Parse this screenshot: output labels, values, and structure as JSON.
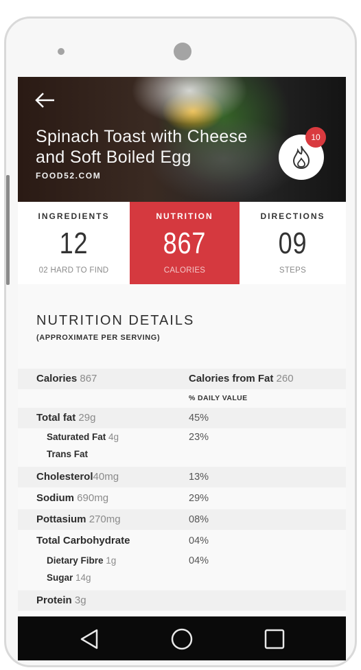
{
  "recipe": {
    "title_line1": "Spinach Toast with Cheese",
    "title_line2": "and Soft Boiled Egg",
    "source": "FOOD52.COM",
    "badge_count": "10"
  },
  "tabs": [
    {
      "label": "INGREDIENTS",
      "value": "12",
      "sub": "02 HARD TO FIND"
    },
    {
      "label": "NUTRITION",
      "value": "867",
      "sub": "CALORIES"
    },
    {
      "label": "DIRECTIONS",
      "value": "09",
      "sub": "STEPS"
    }
  ],
  "nutrition": {
    "heading": "NUTRITION DETAILS",
    "subheading": "(APPROXIMATE PER SERVING)",
    "calories_label": "Calories",
    "calories_value": "867",
    "calories_fat_label": "Calories from Fat",
    "calories_fat_value": "260",
    "daily_value_label": "% DAILY VALUE",
    "rows": [
      {
        "label": "Total fat",
        "amount": "29g",
        "pct": "45%"
      },
      {
        "label": "Saturated Fat",
        "amount": "4g",
        "pct": "23%"
      },
      {
        "label": "Trans Fat",
        "amount": "",
        "pct": ""
      },
      {
        "label": "Cholesterol",
        "amount": "40mg",
        "pct": "13%"
      },
      {
        "label": "Sodium",
        "amount": "690mg",
        "pct": "29%"
      },
      {
        "label": "Pottasium",
        "amount": "270mg",
        "pct": "08%"
      },
      {
        "label": "Total Carbohydrate",
        "amount": "",
        "pct": "04%"
      },
      {
        "label": "Dietary Fibre",
        "amount": "1g",
        "pct": "04%"
      },
      {
        "label": "Sugar",
        "amount": "14g",
        "pct": ""
      },
      {
        "label": "Protein",
        "amount": "3g",
        "pct": ""
      }
    ]
  },
  "colors": {
    "accent": "#d5393f",
    "badge": "#d93a3f",
    "navbar": "#0a0a0a"
  }
}
